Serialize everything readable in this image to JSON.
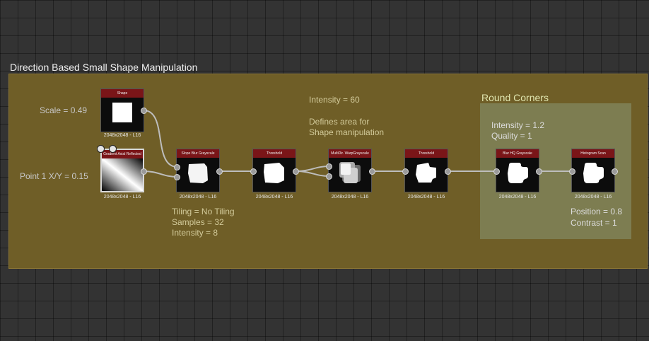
{
  "frame": {
    "title": "Direction Based Small Shape Manipulation"
  },
  "subframe": {
    "title": "Round Corners"
  },
  "labels": {
    "scale": "Scale = 0.49",
    "point": "Point 1 X/Y = 0.15",
    "intensity_line": "Intensity = 60",
    "defines_line1": "Defines area for",
    "defines_line2": "Shape manipulation",
    "tiling": "Tiling = No Tiling",
    "samples": "Samples = 32",
    "intensity8": "Intensity = 8",
    "rc_intensity": "Intensity = 1.2",
    "rc_quality": "Quality = 1",
    "position": "Position = 0.8",
    "contrast": "Contrast = 1"
  },
  "nodes": {
    "shape": {
      "title": "Shape",
      "res": "2048x2048 - L16"
    },
    "gradient": {
      "title": "Gradient Axial Reflected",
      "res": "2048x2048 - L16"
    },
    "slope_blur": {
      "title": "Slope Blur Grayscale",
      "res": "2048x2048 - L16"
    },
    "threshold1": {
      "title": "Threshold",
      "res": "2048x2048 - L16"
    },
    "multidir_warp": {
      "title": "MultiDir. WarpGrayscale",
      "res": "2048x2048 - L16"
    },
    "threshold2": {
      "title": "Threshold",
      "res": "2048x2048 - L16"
    },
    "blur_hq": {
      "title": "Blur HQ Grayscale",
      "res": "2048x2048 - L16"
    },
    "histogram_scan": {
      "title": "Histogram Scan",
      "res": "2048x2048 - L16"
    }
  }
}
